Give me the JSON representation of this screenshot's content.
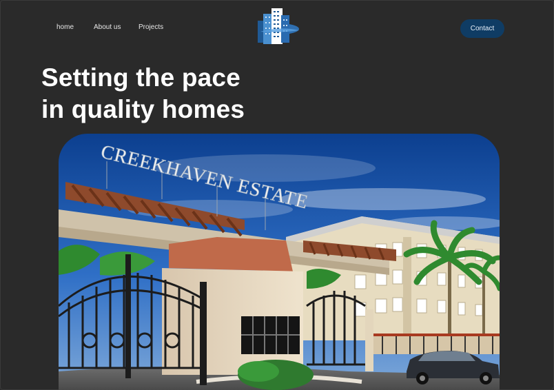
{
  "nav": {
    "links": [
      {
        "label": "home"
      },
      {
        "label": "About us"
      },
      {
        "label": "Projects"
      }
    ],
    "contact_label": "Contact"
  },
  "hero": {
    "title_line1": "Setting the pace",
    "title_line2": "in quality homes",
    "image": {
      "alt": "Creekhaven Estate gate rendering",
      "sign_text": "CREEKHAVEN ESTATE"
    }
  },
  "colors": {
    "background": "#2a2a2a",
    "accent": "#0f3c64",
    "text": "#ffffff"
  },
  "icons": {
    "logo": "building-logo-icon"
  }
}
